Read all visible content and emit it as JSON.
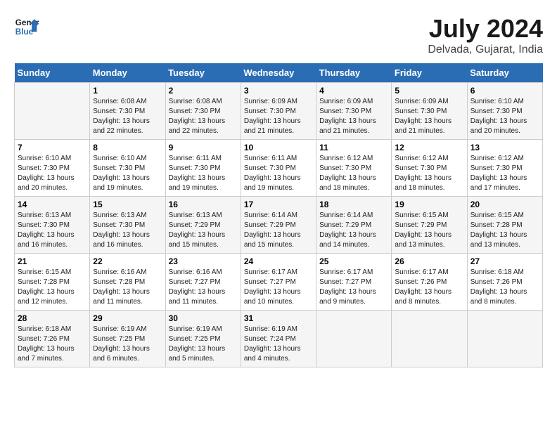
{
  "logo": {
    "text_general": "General",
    "text_blue": "Blue"
  },
  "title": "July 2024",
  "subtitle": "Delvada, Gujarat, India",
  "days_of_week": [
    "Sunday",
    "Monday",
    "Tuesday",
    "Wednesday",
    "Thursday",
    "Friday",
    "Saturday"
  ],
  "weeks": [
    [
      {
        "day": "",
        "info": ""
      },
      {
        "day": "1",
        "info": "Sunrise: 6:08 AM\nSunset: 7:30 PM\nDaylight: 13 hours\nand 22 minutes."
      },
      {
        "day": "2",
        "info": "Sunrise: 6:08 AM\nSunset: 7:30 PM\nDaylight: 13 hours\nand 22 minutes."
      },
      {
        "day": "3",
        "info": "Sunrise: 6:09 AM\nSunset: 7:30 PM\nDaylight: 13 hours\nand 21 minutes."
      },
      {
        "day": "4",
        "info": "Sunrise: 6:09 AM\nSunset: 7:30 PM\nDaylight: 13 hours\nand 21 minutes."
      },
      {
        "day": "5",
        "info": "Sunrise: 6:09 AM\nSunset: 7:30 PM\nDaylight: 13 hours\nand 21 minutes."
      },
      {
        "day": "6",
        "info": "Sunrise: 6:10 AM\nSunset: 7:30 PM\nDaylight: 13 hours\nand 20 minutes."
      }
    ],
    [
      {
        "day": "7",
        "info": ""
      },
      {
        "day": "8",
        "info": "Sunrise: 6:10 AM\nSunset: 7:30 PM\nDaylight: 13 hours\nand 19 minutes."
      },
      {
        "day": "9",
        "info": "Sunrise: 6:11 AM\nSunset: 7:30 PM\nDaylight: 13 hours\nand 19 minutes."
      },
      {
        "day": "10",
        "info": "Sunrise: 6:11 AM\nSunset: 7:30 PM\nDaylight: 13 hours\nand 19 minutes."
      },
      {
        "day": "11",
        "info": "Sunrise: 6:12 AM\nSunset: 7:30 PM\nDaylight: 13 hours\nand 18 minutes."
      },
      {
        "day": "12",
        "info": "Sunrise: 6:12 AM\nSunset: 7:30 PM\nDaylight: 13 hours\nand 18 minutes."
      },
      {
        "day": "13",
        "info": "Sunrise: 6:12 AM\nSunset: 7:30 PM\nDaylight: 13 hours\nand 17 minutes."
      }
    ],
    [
      {
        "day": "14",
        "info": ""
      },
      {
        "day": "15",
        "info": "Sunrise: 6:13 AM\nSunset: 7:30 PM\nDaylight: 13 hours\nand 16 minutes."
      },
      {
        "day": "16",
        "info": "Sunrise: 6:13 AM\nSunset: 7:29 PM\nDaylight: 13 hours\nand 15 minutes."
      },
      {
        "day": "17",
        "info": "Sunrise: 6:14 AM\nSunset: 7:29 PM\nDaylight: 13 hours\nand 15 minutes."
      },
      {
        "day": "18",
        "info": "Sunrise: 6:14 AM\nSunset: 7:29 PM\nDaylight: 13 hours\nand 14 minutes."
      },
      {
        "day": "19",
        "info": "Sunrise: 6:15 AM\nSunset: 7:29 PM\nDaylight: 13 hours\nand 13 minutes."
      },
      {
        "day": "20",
        "info": "Sunrise: 6:15 AM\nSunset: 7:28 PM\nDaylight: 13 hours\nand 13 minutes."
      }
    ],
    [
      {
        "day": "21",
        "info": ""
      },
      {
        "day": "22",
        "info": "Sunrise: 6:16 AM\nSunset: 7:28 PM\nDaylight: 13 hours\nand 11 minutes."
      },
      {
        "day": "23",
        "info": "Sunrise: 6:16 AM\nSunset: 7:27 PM\nDaylight: 13 hours\nand 11 minutes."
      },
      {
        "day": "24",
        "info": "Sunrise: 6:17 AM\nSunset: 7:27 PM\nDaylight: 13 hours\nand 10 minutes."
      },
      {
        "day": "25",
        "info": "Sunrise: 6:17 AM\nSunset: 7:27 PM\nDaylight: 13 hours\nand 9 minutes."
      },
      {
        "day": "26",
        "info": "Sunrise: 6:17 AM\nSunset: 7:26 PM\nDaylight: 13 hours\nand 8 minutes."
      },
      {
        "day": "27",
        "info": "Sunrise: 6:18 AM\nSunset: 7:26 PM\nDaylight: 13 hours\nand 8 minutes."
      }
    ],
    [
      {
        "day": "28",
        "info": "Sunrise: 6:18 AM\nSunset: 7:26 PM\nDaylight: 13 hours\nand 7 minutes."
      },
      {
        "day": "29",
        "info": "Sunrise: 6:19 AM\nSunset: 7:25 PM\nDaylight: 13 hours\nand 6 minutes."
      },
      {
        "day": "30",
        "info": "Sunrise: 6:19 AM\nSunset: 7:25 PM\nDaylight: 13 hours\nand 5 minutes."
      },
      {
        "day": "31",
        "info": "Sunrise: 6:19 AM\nSunset: 7:24 PM\nDaylight: 13 hours\nand 4 minutes."
      },
      {
        "day": "",
        "info": ""
      },
      {
        "day": "",
        "info": ""
      },
      {
        "day": "",
        "info": ""
      }
    ]
  ],
  "week1_sun_info": "Sunrise: 6:10 AM\nSunset: 7:30 PM\nDaylight: 13 hours\nand 20 minutes.",
  "week3_sun_info": "Sunrise: 6:13 AM\nSunset: 7:30 PM\nDaylight: 13 hours\nand 16 minutes.",
  "week4_sun_info": "Sunrise: 6:15 AM\nSunset: 7:28 PM\nDaylight: 13 hours\nand 12 minutes."
}
